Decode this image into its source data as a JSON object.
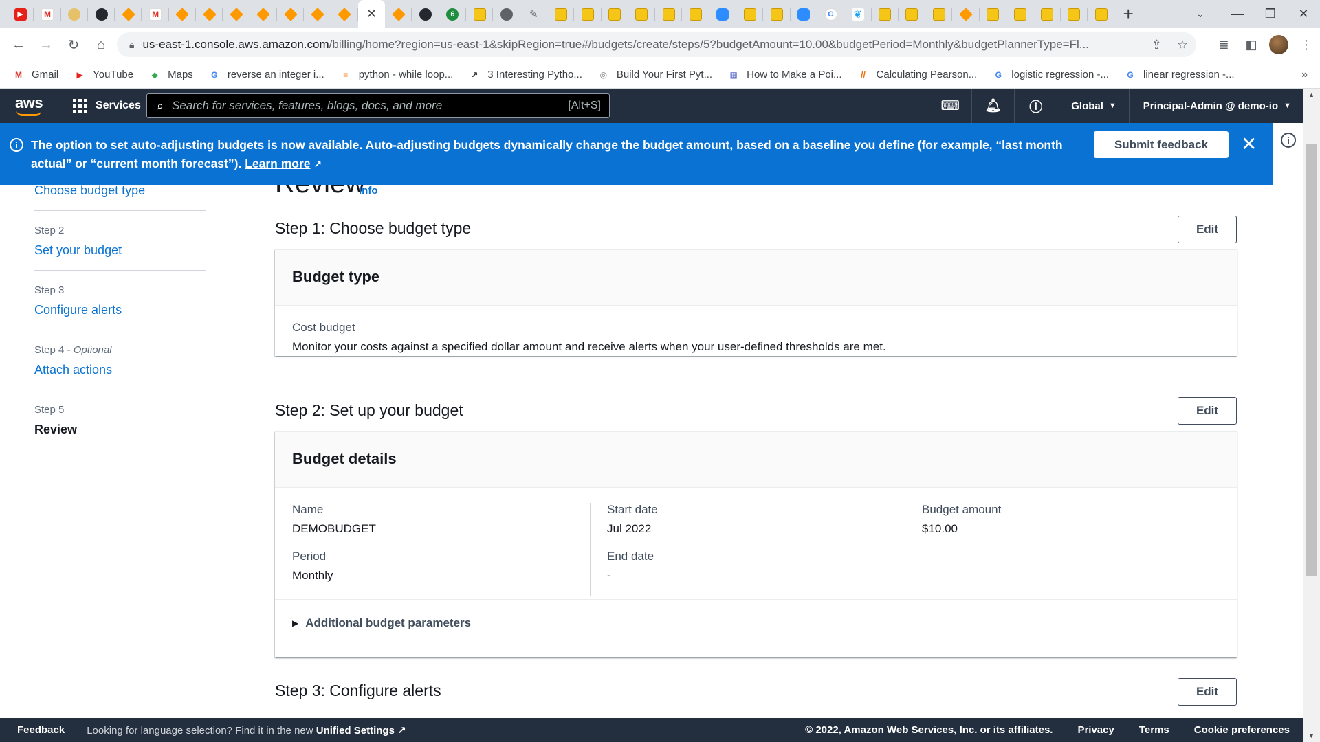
{
  "browser": {
    "tabs": [
      {
        "icon": "youtube-icon",
        "glyph": "▶",
        "cls": "yt"
      },
      {
        "icon": "gmail-icon",
        "glyph": "M",
        "cls": "gm"
      },
      {
        "icon": "beige-site-icon",
        "glyph": "",
        "cls": "beige"
      },
      {
        "icon": "github-icon",
        "glyph": "",
        "cls": "gh"
      },
      {
        "icon": "aws-icon",
        "glyph": "",
        "cls": "aws"
      },
      {
        "icon": "gmail-icon",
        "glyph": "M",
        "cls": "gm"
      },
      {
        "icon": "aws-icon",
        "glyph": "",
        "cls": "aws"
      },
      {
        "icon": "aws-icon",
        "glyph": "",
        "cls": "aws"
      },
      {
        "icon": "aws-icon",
        "glyph": "",
        "cls": "aws"
      },
      {
        "icon": "aws-icon",
        "glyph": "",
        "cls": "aws"
      },
      {
        "icon": "aws-icon",
        "glyph": "",
        "cls": "aws"
      },
      {
        "icon": "aws-icon",
        "glyph": "",
        "cls": "aws"
      },
      {
        "icon": "aws-icon",
        "glyph": "",
        "cls": "aws"
      },
      {
        "icon": "close-icon",
        "glyph": "✕",
        "cls": "active"
      },
      {
        "icon": "aws-icon",
        "glyph": "",
        "cls": "aws"
      },
      {
        "icon": "github-icon",
        "glyph": "",
        "cls": "gh"
      },
      {
        "icon": "green-circle-icon",
        "glyph": "6",
        "cls": "grn"
      },
      {
        "icon": "box-icon",
        "glyph": "",
        "cls": "box"
      },
      {
        "icon": "chromium-icon",
        "glyph": "",
        "cls": "chrm"
      },
      {
        "icon": "pen-icon",
        "glyph": "✎",
        "cls": "pen"
      },
      {
        "icon": "box-icon",
        "glyph": "",
        "cls": "box"
      },
      {
        "icon": "box-icon",
        "glyph": "",
        "cls": "box"
      },
      {
        "icon": "box-icon",
        "glyph": "",
        "cls": "box"
      },
      {
        "icon": "box-icon",
        "glyph": "",
        "cls": "box"
      },
      {
        "icon": "box-icon",
        "glyph": "",
        "cls": "box"
      },
      {
        "icon": "box-icon",
        "glyph": "",
        "cls": "box"
      },
      {
        "icon": "zoom-icon",
        "glyph": "",
        "cls": "zm"
      },
      {
        "icon": "box-icon",
        "glyph": "",
        "cls": "box"
      },
      {
        "icon": "box-icon",
        "glyph": "",
        "cls": "box"
      },
      {
        "icon": "zoom-icon",
        "glyph": "",
        "cls": "zm"
      },
      {
        "icon": "google-icon",
        "glyph": "G",
        "cls": "gg"
      },
      {
        "icon": "twitter-icon",
        "glyph": "❦",
        "cls": "tw"
      },
      {
        "icon": "box-icon",
        "glyph": "",
        "cls": "box"
      },
      {
        "icon": "box-icon",
        "glyph": "",
        "cls": "box"
      },
      {
        "icon": "box-icon",
        "glyph": "",
        "cls": "box"
      },
      {
        "icon": "aws-icon",
        "glyph": "",
        "cls": "aws"
      },
      {
        "icon": "box-icon",
        "glyph": "",
        "cls": "box"
      },
      {
        "icon": "box-icon",
        "glyph": "",
        "cls": "box"
      },
      {
        "icon": "box-icon",
        "glyph": "",
        "cls": "box"
      },
      {
        "icon": "box-icon",
        "glyph": "",
        "cls": "box"
      },
      {
        "icon": "box-icon",
        "glyph": "",
        "cls": "box"
      }
    ],
    "url_host": "us-east-1.console.aws.amazon.com",
    "url_path": "/billing/home?region=us-east-1&skipRegion=true#/budgets/create/steps/5?budgetAmount=10.00&budgetPeriod=Monthly&budgetPlannerType=Fl...",
    "bookmarks": [
      {
        "label": "Gmail",
        "icon": "gmail-icon",
        "glyph": "M",
        "color": "#d93025"
      },
      {
        "label": "YouTube",
        "icon": "youtube-icon",
        "glyph": "▶",
        "color": "#e62117"
      },
      {
        "label": "Maps",
        "icon": "maps-icon",
        "glyph": "◆",
        "color": "#34a853"
      },
      {
        "label": "reverse an integer i...",
        "icon": "google-icon",
        "glyph": "G",
        "color": "#4285f4"
      },
      {
        "label": "python - while loop...",
        "icon": "stackoverflow-icon",
        "glyph": "≡",
        "color": "#f48024"
      },
      {
        "label": "3 Interesting Pytho...",
        "icon": "chart-line-icon",
        "glyph": "↗",
        "color": "#202124"
      },
      {
        "label": "Build Your First Pyt...",
        "icon": "circle-logo-icon",
        "glyph": "◎",
        "color": "#7a7a7a"
      },
      {
        "label": "How to Make a Poi...",
        "icon": "image-icon",
        "glyph": "▦",
        "color": "#5b6cc9"
      },
      {
        "label": "Calculating Pearson...",
        "icon": "slash-logo-icon",
        "glyph": "//",
        "color": "#e8710a"
      },
      {
        "label": "logistic regression -...",
        "icon": "google-icon",
        "glyph": "G",
        "color": "#4285f4"
      },
      {
        "label": "linear regression -...",
        "icon": "google-icon",
        "glyph": "G",
        "color": "#4285f4"
      }
    ]
  },
  "awsnav": {
    "logo": "aws",
    "services": "Services",
    "search_placeholder": "Search for services, features, blogs, docs, and more",
    "search_shortcut": "[Alt+S]",
    "region": "Global",
    "account": "Principal-Admin @ demo-io"
  },
  "banner": {
    "message": "The option to set auto-adjusting budgets is now available. Auto-adjusting budgets dynamically change the budget amount, based on a baseline you define (for example, “last month actual” or “current month forecast”).",
    "learn_more": "Learn more",
    "feedback_button": "Submit feedback"
  },
  "leftnav": {
    "step1_link": "Choose budget type",
    "steps": [
      {
        "step": "Step 2",
        "optional": "",
        "label": "Set your budget"
      },
      {
        "step": "Step 3",
        "optional": "",
        "label": "Configure alerts"
      },
      {
        "step": "Step 4 - ",
        "optional": "Optional",
        "label": "Attach actions"
      }
    ],
    "current_step": "Step 5",
    "current_label": "Review"
  },
  "page": {
    "title": "Review",
    "info": "Info",
    "edit": "Edit"
  },
  "step1": {
    "heading": "Step 1: Choose budget type",
    "card_title": "Budget type",
    "label": "Cost budget",
    "description": "Monitor your costs against a specified dollar amount and receive alerts when your user-defined thresholds are met."
  },
  "step2": {
    "heading": "Step 2: Set up your budget",
    "card_title": "Budget details",
    "name_label": "Name",
    "name_value": "DEMOBUDGET",
    "period_label": "Period",
    "period_value": "Monthly",
    "start_label": "Start date",
    "start_value": "Jul 2022",
    "end_label": "End date",
    "end_value": "-",
    "amount_label": "Budget amount",
    "amount_value": "$10.00",
    "additional": "Additional budget parameters"
  },
  "step3": {
    "heading": "Step 3: Configure alerts"
  },
  "footer": {
    "feedback": "Feedback",
    "lang_prefix": "Looking for language selection? Find it in the new ",
    "lang_link": "Unified Settings",
    "copyright": "© 2022, Amazon Web Services, Inc. or its affiliates.",
    "privacy": "Privacy",
    "terms": "Terms",
    "cookies": "Cookie preferences"
  }
}
